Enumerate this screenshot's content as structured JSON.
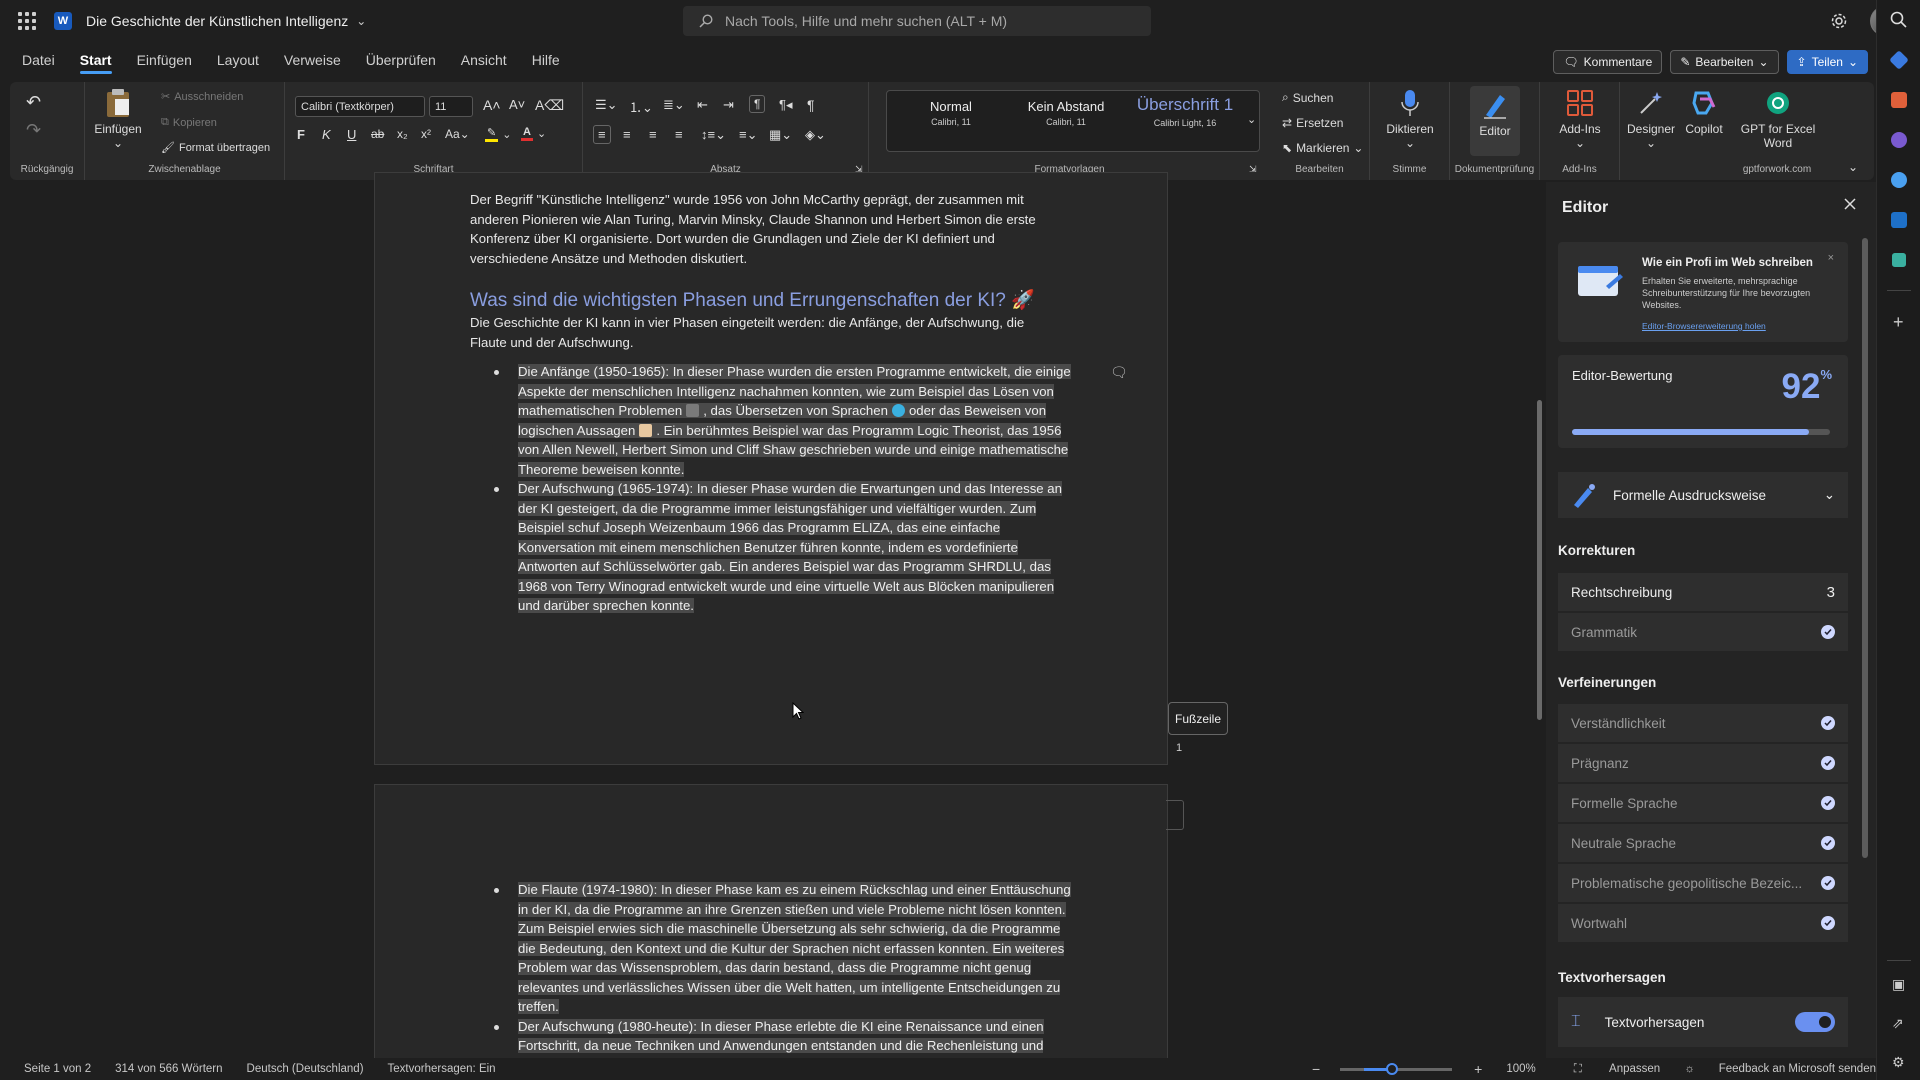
{
  "title_bar": {
    "doc_title": "Die Geschichte der Künstlichen Intelligenz",
    "search_placeholder": "Nach Tools, Hilfe und mehr suchen (ALT + M)"
  },
  "menu": {
    "tabs": [
      "Datei",
      "Start",
      "Einfügen",
      "Layout",
      "Verweise",
      "Überprüfen",
      "Ansicht",
      "Hilfe"
    ],
    "active_tab": "Start",
    "comments": "Kommentare",
    "edit": "Bearbeiten",
    "share": "Teilen"
  },
  "ribbon": {
    "undo_label": "Rückgängig",
    "clipboard": {
      "paste": "Einfügen",
      "cut": "Ausschneiden",
      "copy": "Kopieren",
      "format_painter": "Format übertragen",
      "label": "Zwischenablage"
    },
    "font": {
      "family": "Calibri (Textkörper)",
      "size": "11",
      "label": "Schriftart"
    },
    "paragraph_label": "Absatz",
    "styles": {
      "items": [
        {
          "name": "Normal",
          "sub": "Calibri, 11"
        },
        {
          "name": "Kein Abstand",
          "sub": "Calibri, 11"
        },
        {
          "name": "Überschrift 1",
          "sub": "Calibri Light, 16"
        }
      ],
      "label": "Formatvorlagen"
    },
    "editing": {
      "find": "Suchen",
      "replace": "Ersetzen",
      "select": "Markieren",
      "label": "Bearbeiten"
    },
    "voice": {
      "dictate": "Diktieren",
      "label": "Stimme"
    },
    "editor": {
      "button": "Editor",
      "label": "Dokumentprüfung"
    },
    "addins": {
      "button": "Add-Ins",
      "label": "Add-Ins"
    },
    "designer": "Designer",
    "copilot": "Copilot",
    "gpt": {
      "button_line1": "GPT for Excel",
      "button_line2": "Word",
      "label": "gptforwork.com"
    }
  },
  "document": {
    "intro_lines": [
      "Der Begriff \"Künstliche Intelligenz\" wurde 1956 von John McCarthy geprägt, der zusammen mit",
      "anderen Pionieren wie Alan Turing, Marvin Minsky, Claude Shannon und Herbert Simon die erste",
      "Konferenz über KI organisierte. Dort wurden die Grundlagen und Ziele der KI definiert und",
      "verschiedene Ansätze und Methoden diskutiert."
    ],
    "heading": "Was sind die wichtigsten Phasen und Errungenschaften der KI?",
    "heading_emoji": "🚀",
    "phases_intro_lines": [
      "Die Geschichte der KI kann in vier Phasen eingeteilt werden: die Anfänge, der Aufschwung, die",
      "Flaute und der Aufschwung."
    ],
    "bullet1": {
      "text1": "Die Anfänge (1950-1965): In dieser Phase wurden die ersten Programme entwickelt, die einige Aspekte der menschlichen Intelligenz nachahmen konnten, wie zum Beispiel das Lösen von mathematischen Problemen",
      "text2": ", das Übersetzen von Sprachen",
      "text3": "oder das Beweisen von logischen Aussagen",
      "text4": ". Ein berühmtes Beispiel war das Programm Logic Theorist, das 1956 von Allen Newell, Herbert Simon und Cliff Shaw geschrieben wurde und einige mathematische Theoreme beweisen konnte."
    },
    "bullet2": "Der Aufschwung (1965-1974): In dieser Phase wurden die Erwartungen und das Interesse an der KI gesteigert, da die Programme immer leistungsfähiger und vielfältiger wurden. Zum Beispiel schuf Joseph Weizenbaum 1966 das Programm ELIZA, das eine einfache Konversation mit einem menschlichen Benutzer führen konnte, indem es vordefinierte Antworten auf Schlüsselwörter gab. Ein anderes Beispiel war das Programm SHRDLU, das 1968 von Terry Winograd entwickelt wurde und eine virtuelle Welt aus Blöcken manipulieren und darüber sprechen konnte.",
    "bullet3": "Die Flaute (1974-1980): In dieser Phase kam es zu einem Rückschlag und einer Enttäuschung in der KI, da die Programme an ihre Grenzen stießen und viele Probleme nicht lösen konnten. Zum Beispiel erwies sich die maschinelle Übersetzung als sehr schwierig, da die Programme die Bedeutung, den Kontext und die Kultur der Sprachen nicht erfassen konnten. Ein weiteres Problem war das Wissensproblem, das darin bestand, dass die Programme nicht genug relevantes und verlässliches Wissen über die Welt hatten, um intelligente Entscheidungen zu treffen.",
    "bullet4": "Der Aufschwung (1980-heute): In dieser Phase erlebte die KI eine Renaissance und einen Fortschritt, da neue Techniken und Anwendungen entstanden und die Rechenleistung und",
    "footer_label": "Fußzeile",
    "page_number": "1"
  },
  "editor_pane": {
    "title": "Editor",
    "promo": {
      "title": "Wie ein Profi im Web schreiben",
      "body": "Erhalten Sie erweiterte, mehrsprachige Schreibunterstützung für Ihre bevorzugten Websites.",
      "link": "Editor-Browsererweiterung holen"
    },
    "score": {
      "label": "Editor-Bewertung",
      "value": "92",
      "unit": "%",
      "fraction": 0.92
    },
    "style": "Formelle Ausdrucksweise",
    "corrections_title": "Korrekturen",
    "corrections": [
      {
        "label": "Rechtschreibung",
        "count": "3"
      },
      {
        "label": "Grammatik"
      }
    ],
    "refinements_title": "Verfeinerungen",
    "refinements": [
      "Verständlichkeit",
      "Prägnanz",
      "Formelle Sprache",
      "Neutrale Sprache",
      "Problematische geopolitische Bezeic...",
      "Wortwahl"
    ],
    "predictions_title": "Textvorhersagen",
    "predictions_label": "Textvorhersagen",
    "predictions_on": true
  },
  "status": {
    "page": "Seite 1 von 2",
    "words": "314 von 566 Wörtern",
    "language": "Deutsch (Deutschland)",
    "predictions": "Textvorhersagen: Ein",
    "zoom": "100%",
    "fit": "Anpassen",
    "feedback": "Feedback an Microsoft senden"
  },
  "colors": {
    "accent": "#479ef5",
    "share_button": "#2e6bc4",
    "heading": "#8a9ee0",
    "selection": "#4a4a4a"
  }
}
